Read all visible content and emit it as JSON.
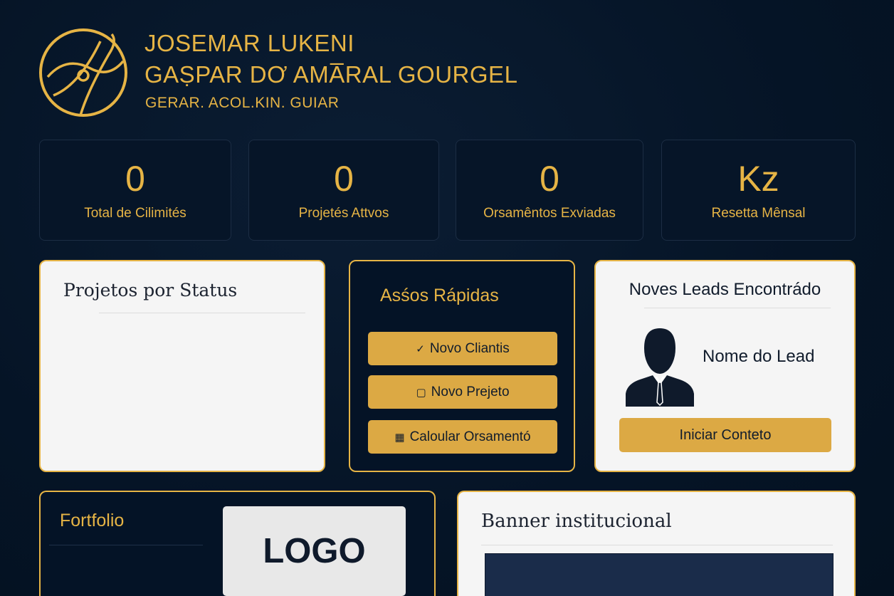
{
  "header": {
    "name_line1": "JOSEMAR LUKENI",
    "name_line2": "GAṢPAR DƠ AMA̅RAL GOURGEL",
    "tagline": "GERAR. ACOL.KIN. GUIAR",
    "logo_icon": "circle-emblem-icon"
  },
  "stats": [
    {
      "value": "0",
      "label": "Total de Cilimités"
    },
    {
      "value": "0",
      "label": "Projetés Attvos"
    },
    {
      "value": "0",
      "label": "Orsamêntos Exviadas"
    },
    {
      "value": "Kz",
      "label": "Resetta Mênsal"
    }
  ],
  "status_panel": {
    "title": "Projetos por Status"
  },
  "quick_actions": {
    "title": "Asśos Rápidas",
    "buttons": [
      {
        "icon": "check-icon",
        "glyph": "✓",
        "label": "Novo Cliantis"
      },
      {
        "icon": "folder-icon",
        "glyph": "▢",
        "label": "Novo Prejeto"
      },
      {
        "icon": "calculator-icon",
        "glyph": "▦",
        "label": "Caloular Orsamentó"
      }
    ]
  },
  "leads": {
    "title": "Noves Leads Encontrádo",
    "lead_name": "Nome do Lead",
    "contact_button": "Iniciar Conteto",
    "avatar_icon": "person-silhouette-icon"
  },
  "portfolio": {
    "title": "Fortfolio",
    "logo_text": "LOGO"
  },
  "banner": {
    "title": "Banner institucional"
  },
  "colors": {
    "background": "#051426",
    "gold": "#e6b445",
    "button_gold": "#dca944",
    "panel_light": "#f5f5f5",
    "text_dark": "#111c2c"
  }
}
